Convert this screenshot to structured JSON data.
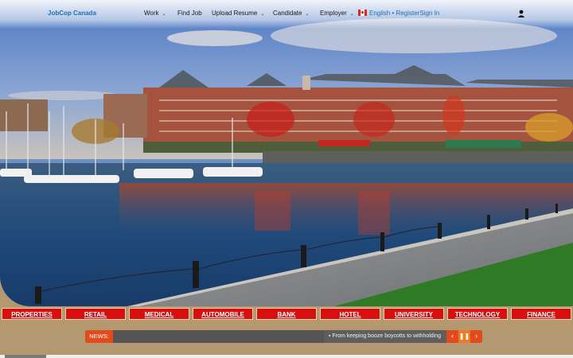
{
  "header": {
    "brand": "JobCop Canada",
    "nav": [
      {
        "label": "Work",
        "has_dropdown": true
      },
      {
        "label": "Find Job",
        "has_dropdown": false
      },
      {
        "label": "Upload Resume",
        "has_dropdown": true
      },
      {
        "label": "Candidate",
        "has_dropdown": true
      },
      {
        "label": "Employer",
        "has_dropdown": true
      }
    ],
    "language": "English",
    "separator": "•",
    "register": "Register",
    "sign_in": "Sign In",
    "flag_icon": "canada-flag-icon",
    "user_icon": "user-icon"
  },
  "categories": [
    "PROPERTIES",
    "RETAIL",
    "MEDICAL",
    "AUTOMOBILE",
    "BANK",
    "HOTEL",
    "UNIVERSITY",
    "TECHNOLOGY",
    "FINANCE"
  ],
  "news": {
    "label": "NEWS:",
    "headline": "From keeping booze boycotts to withholding",
    "prev_icon": "chevron-left-icon",
    "pause_icon": "pause-icon",
    "next_icon": "chevron-right-icon"
  },
  "colors": {
    "category_bg": "#d90e0e",
    "news_accent": "#e24a1c",
    "brand": "#1e6fb8",
    "page_bg": "#b39870"
  }
}
